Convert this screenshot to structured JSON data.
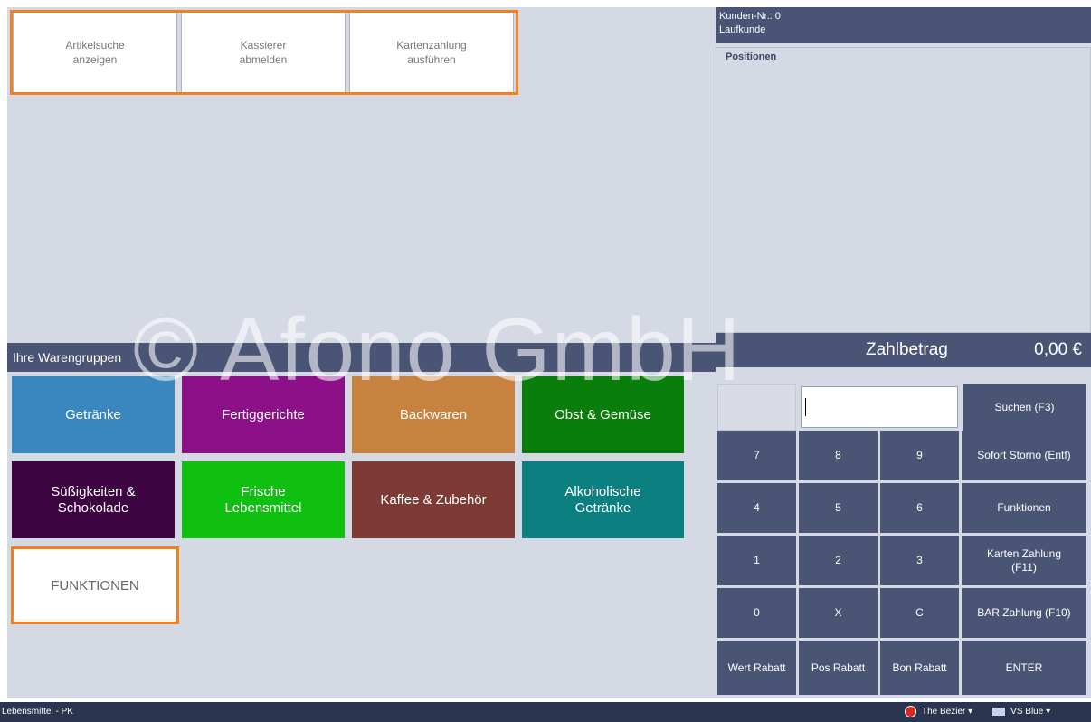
{
  "quick_buttons": [
    {
      "label": "Artikelsuche\nanzeigen"
    },
    {
      "label": "Kassierer\nabmelden"
    },
    {
      "label": "Kartenzahlung\nausführen"
    }
  ],
  "warengruppen": {
    "title": "Ihre Warengruppen",
    "items": [
      {
        "label": "Getränke",
        "color": "#3a87c0"
      },
      {
        "label": "Fertiggerichte",
        "color": "#8c1088"
      },
      {
        "label": "Backwaren",
        "color": "#c88240"
      },
      {
        "label": "Obst & Gemüse",
        "color": "#0a7e0a"
      },
      {
        "label": "Süßigkeiten &\nSchokolade",
        "color": "#3c0440"
      },
      {
        "label": "Frische\nLebensmittel",
        "color": "#10c010"
      },
      {
        "label": "Kaffee & Zubehör",
        "color": "#7c3b35"
      },
      {
        "label": "Alkoholische\nGetränke",
        "color": "#0c7f80"
      }
    ],
    "funktionen_label": "FUNKTIONEN"
  },
  "customer": {
    "number_line": "Kunden-Nr.: 0",
    "type_line": "Laufkunde"
  },
  "positions": {
    "title": "Positionen"
  },
  "payment": {
    "label": "Zahlbetrag",
    "amount": "0,00 €"
  },
  "keypad": {
    "search_label": "Suchen (F3)",
    "rows": [
      [
        "7",
        "8",
        "9",
        "Sofort Storno (Entf)"
      ],
      [
        "4",
        "5",
        "6",
        "Funktionen"
      ],
      [
        "1",
        "2",
        "3",
        "Karten Zahlung\n(F11)"
      ],
      [
        "0",
        "X",
        "C",
        "BAR Zahlung (F10)"
      ],
      [
        "Wert Rabatt",
        "Pos Rabatt",
        "Bon Rabatt",
        "ENTER"
      ]
    ]
  },
  "status_bar": {
    "left_text": "Lebensmittel - PK",
    "theme_label": "The Bezier ▾",
    "vs_label": "VS Blue ▾"
  },
  "watermark": "© Afono GmbH",
  "colors": {
    "accent_orange": "#f08020",
    "panel_navy": "#4a5576",
    "background": "#d5d9e4"
  }
}
